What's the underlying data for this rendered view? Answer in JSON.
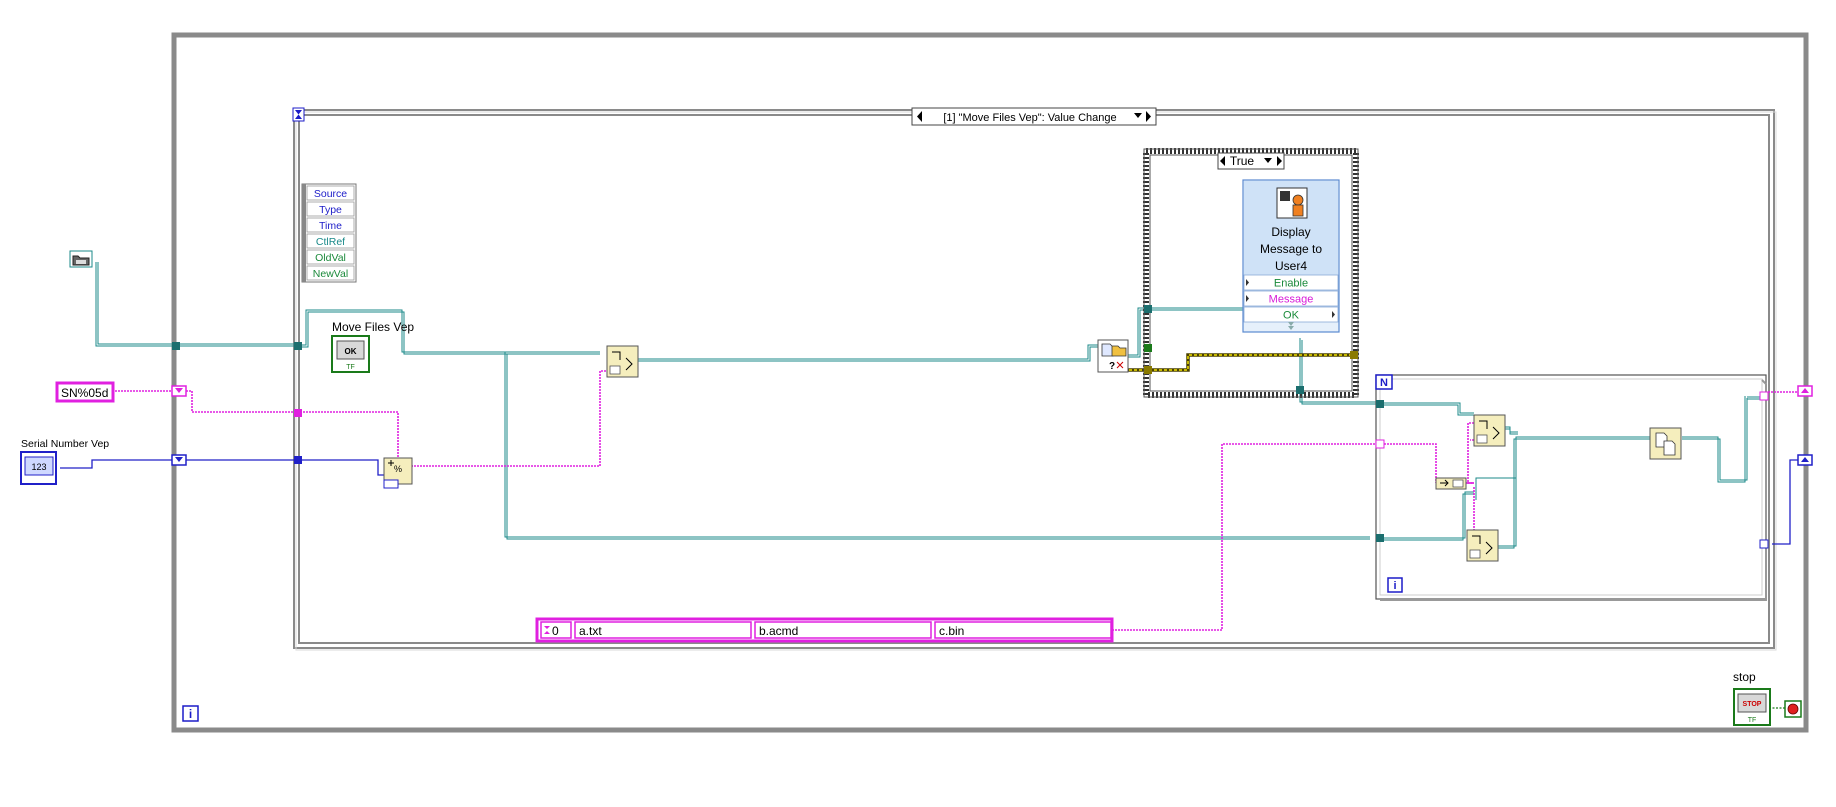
{
  "while_loop": {
    "iteration_terminal": "i"
  },
  "event_structure": {
    "case_label": "[1] \"Move Files Vep\": Value Change",
    "event_data_fields": [
      {
        "label": "Source",
        "color": "blue"
      },
      {
        "label": "Type",
        "color": "blue"
      },
      {
        "label": "Time",
        "color": "blue"
      },
      {
        "label": "CtlRef",
        "color": "teal"
      },
      {
        "label": "OldVal",
        "color": "green"
      },
      {
        "label": "NewVal",
        "color": "green"
      }
    ]
  },
  "controls": {
    "move_files_vep": {
      "label": "Move Files Vep",
      "button_text": "OK",
      "tf": "TF"
    },
    "serial_number_vep": {
      "label": "Serial Number Vep",
      "type_text": "123"
    },
    "format_string": "SN%05d",
    "stop": {
      "label": "stop",
      "button_text": "STOP",
      "tf": "TF"
    }
  },
  "case_structure": {
    "selector": "True",
    "subvi": {
      "title": "Display Message to User4",
      "terminals": [
        {
          "label": "Enable",
          "color": "green"
        },
        {
          "label": "Message",
          "color": "magenta"
        },
        {
          "label": "OK",
          "color": "green"
        }
      ]
    }
  },
  "for_loop": {
    "count_terminal": "N",
    "iteration_terminal": "i"
  },
  "array_constant": {
    "index": "0",
    "items": [
      "a.txt",
      "b.acmd",
      "c.bin"
    ]
  },
  "colors": {
    "path_wire": "#1b8a8a",
    "string_wire": "#e020e0",
    "numeric_wire": "#2020c8",
    "boolean_wire": "#1a7a1a",
    "error_wire": "#8a7a00",
    "structure_frame": "#8a8a8a"
  }
}
